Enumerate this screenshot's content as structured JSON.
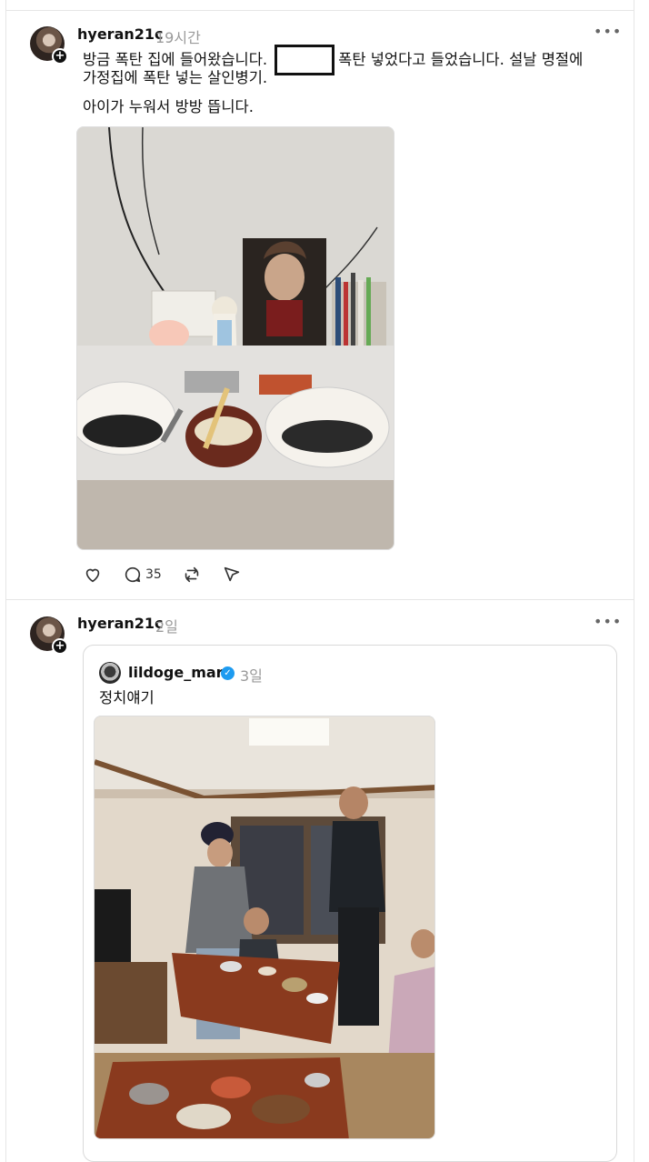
{
  "posts": [
    {
      "username": "hyeran21c",
      "timestamp": "19시간",
      "text_line1_before": "방금 폭탄 집에 들어왔습니다.",
      "text_line1_after": "폭탄 넣었다고 들었습니다. 설날 명절에",
      "text_line2": "가정집에 폭탄 넣는 살인병기.",
      "text_line3": "아이가 누워서 방방 뜹니다.",
      "actions": {
        "like": "",
        "comment_count": "35",
        "repost": "",
        "share": ""
      }
    },
    {
      "username": "hyeran21c",
      "timestamp": "2일",
      "quote": {
        "username": "lildoge_mars",
        "verified": true,
        "timestamp": "3일",
        "text": "정치얘기"
      }
    }
  ],
  "icons": {
    "more": "more-options-icon",
    "like": "heart-icon",
    "comment": "comment-icon",
    "repost": "repost-icon",
    "share": "send-icon",
    "verified": "verified-badge-icon"
  },
  "colors": {
    "text": "#111111",
    "muted": "#9a9a9a",
    "border": "#e6e6e6",
    "verified": "#1d9bf0"
  }
}
